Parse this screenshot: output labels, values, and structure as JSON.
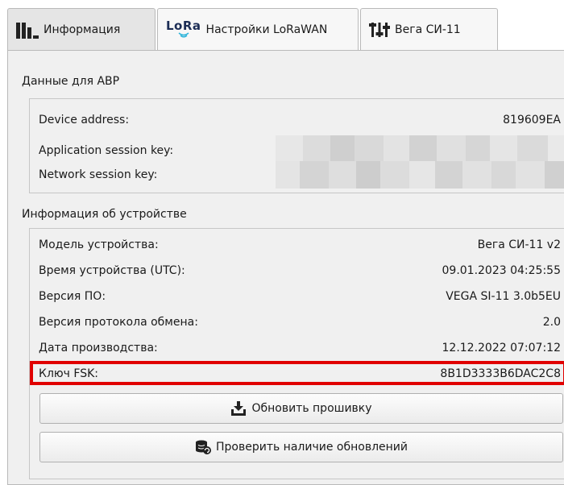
{
  "tabs": [
    {
      "label": "Информация",
      "icon": "bar-chart-icon",
      "active": true
    },
    {
      "label": "Настройки LoRaWAN",
      "icon": "lora-logo-icon",
      "logo_text": "LoRa",
      "active": false
    },
    {
      "label": "Вега СИ-11",
      "icon": "sliders-icon",
      "active": false
    }
  ],
  "abp": {
    "title": "Данные для ABP",
    "device_address_label": "Device address:",
    "device_address_value": "819609EA",
    "app_session_key_label": "Application session key:",
    "network_session_key_label": "Network session key:"
  },
  "device_info": {
    "title": "Информация об устройстве",
    "rows": [
      {
        "label": "Модель устройства:",
        "value": "Вега СИ-11 v2"
      },
      {
        "label": "Время устройства (UTC):",
        "value": "09.01.2023 04:25:55"
      },
      {
        "label": "Версия ПО:",
        "value": "VEGA SI-11 3.0b5EU"
      },
      {
        "label": "Версия протокола обмена:",
        "value": "2.0"
      },
      {
        "label": "Дата производства:",
        "value": "12.12.2022 07:07:12"
      },
      {
        "label": "Ключ FSK:",
        "value": "8B1D3333B6DAC2C8"
      }
    ]
  },
  "buttons": {
    "update_firmware": "Обновить прошивку",
    "check_updates": "Проверить наличие обновлений"
  },
  "colors": {
    "highlight": "#e00000",
    "panel": "#f0f0f0",
    "lora_logo": "#1c2d55"
  }
}
